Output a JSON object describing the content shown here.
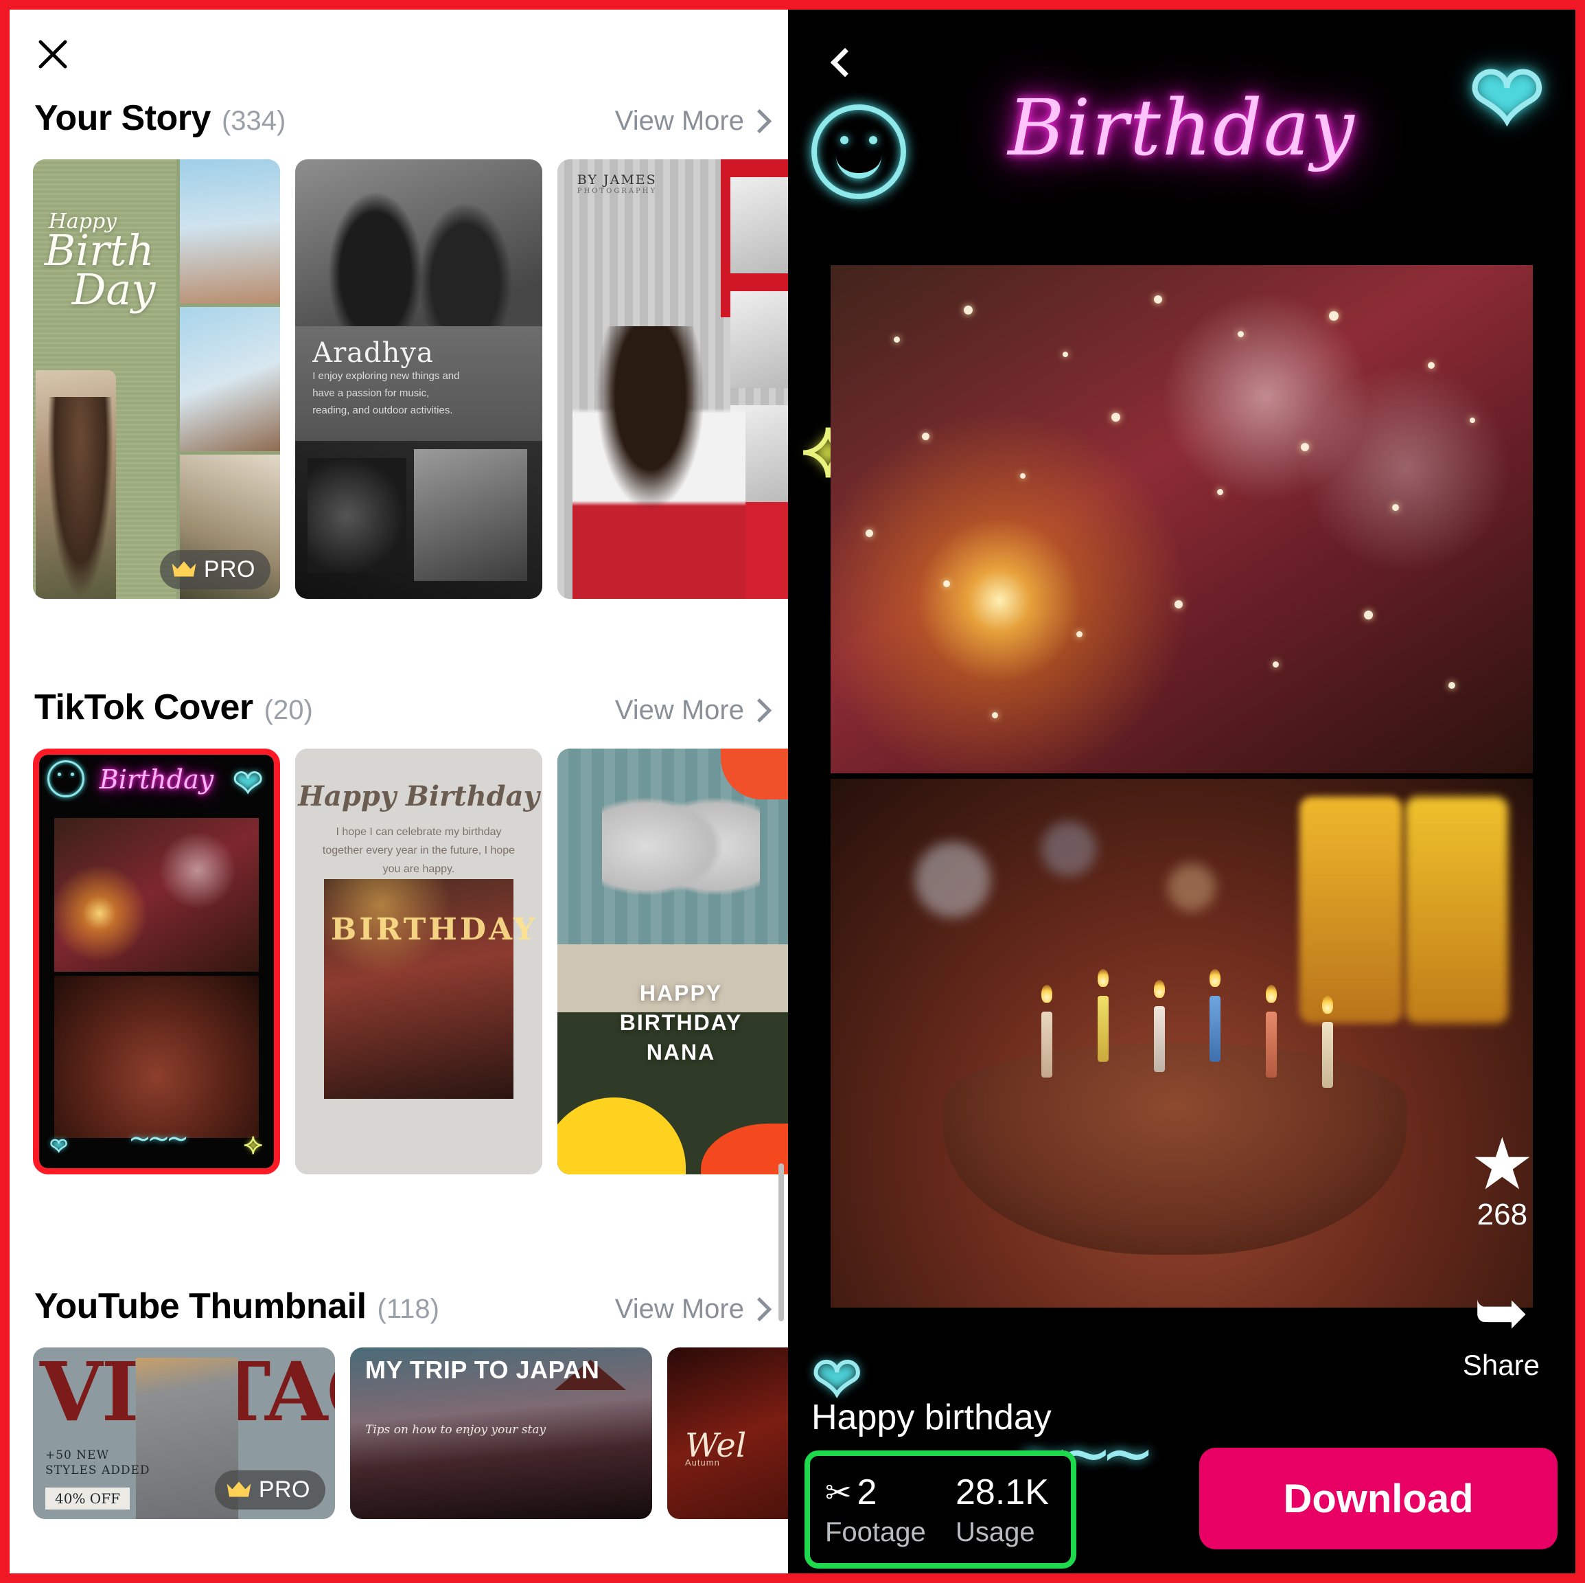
{
  "left": {
    "close_icon": "close-icon",
    "sections": [
      {
        "title": "Your Story",
        "count": "(334)",
        "view_more": "View More",
        "cards": [
          {
            "name": "happy-birthday-collage",
            "pro": true,
            "pro_label": "PRO",
            "text_line1": "Happy",
            "text_line2": "Birth",
            "text_line3": "Day"
          },
          {
            "name": "aradhya-bw-magazine",
            "pro": false,
            "title": "Aradhya",
            "body": "I enjoy exploring new things and have a passion for music, reading, and outdoor activities."
          },
          {
            "name": "red-fashion-collage",
            "pro": false,
            "label": "BY JAMES",
            "sublabel": "PHOTOGRAPHY"
          }
        ]
      },
      {
        "title": "TikTok Cover",
        "count": "(20)",
        "view_more": "View More",
        "cards": [
          {
            "name": "neon-birthday-cover",
            "selected": true,
            "title": "Birthday"
          },
          {
            "name": "happy-birthday-beige-cover",
            "selected": false,
            "title": "Happy Birthday",
            "body": "I hope I can celebrate my birthday together every year in the future, I hope you are happy.",
            "overlay_word": "BIRTHDAY"
          },
          {
            "name": "balloon-18-cover",
            "selected": false,
            "line1": "HAPPY",
            "line2": "BIRTHDAY",
            "line3": "NANA"
          }
        ]
      },
      {
        "title": "YouTube Thumbnail",
        "count": "(118)",
        "view_more": "View More",
        "cards": [
          {
            "name": "vintage-thumbnail",
            "pro": true,
            "pro_label": "PRO",
            "headline": "VINTAG",
            "sub": "+50 NEW\nSTYLES ADDED",
            "badge": "40% OFF"
          },
          {
            "name": "japan-trip-thumbnail",
            "pro": false,
            "headline": "MY TRIP TO JAPAN",
            "sub": "Tips on how to enjoy your stay"
          },
          {
            "name": "autumn-welcome-thumbnail",
            "pro": false,
            "headline": "Wel",
            "sub": "Autumn"
          }
        ]
      }
    ]
  },
  "right": {
    "back_icon": "back-arrow-icon",
    "heart_icon": "heart-outline-icon",
    "smiley_icon": "smiley-face-icon",
    "star_icon": "star-sparkle-icon",
    "neon_title": "Birthday",
    "caption": "Happy birthday",
    "favorite": {
      "icon": "star-icon",
      "count": "268"
    },
    "share": {
      "icon": "share-arrow-icon",
      "label": "Share"
    },
    "stats": [
      {
        "icon": "scissors-icon",
        "value": "2",
        "label": "Footage"
      },
      {
        "icon": "",
        "value": "28.1K",
        "label": "Usage"
      }
    ],
    "download_label": "Download"
  },
  "colors": {
    "frame_red": "#F01824",
    "selected_red": "#FF1A26",
    "stats_green": "#1ED94B",
    "download_pink": "#E80064",
    "neon_magenta": "#FF33E4",
    "neon_cyan": "#9AE9EE",
    "muted_grey": "#8A9099"
  }
}
